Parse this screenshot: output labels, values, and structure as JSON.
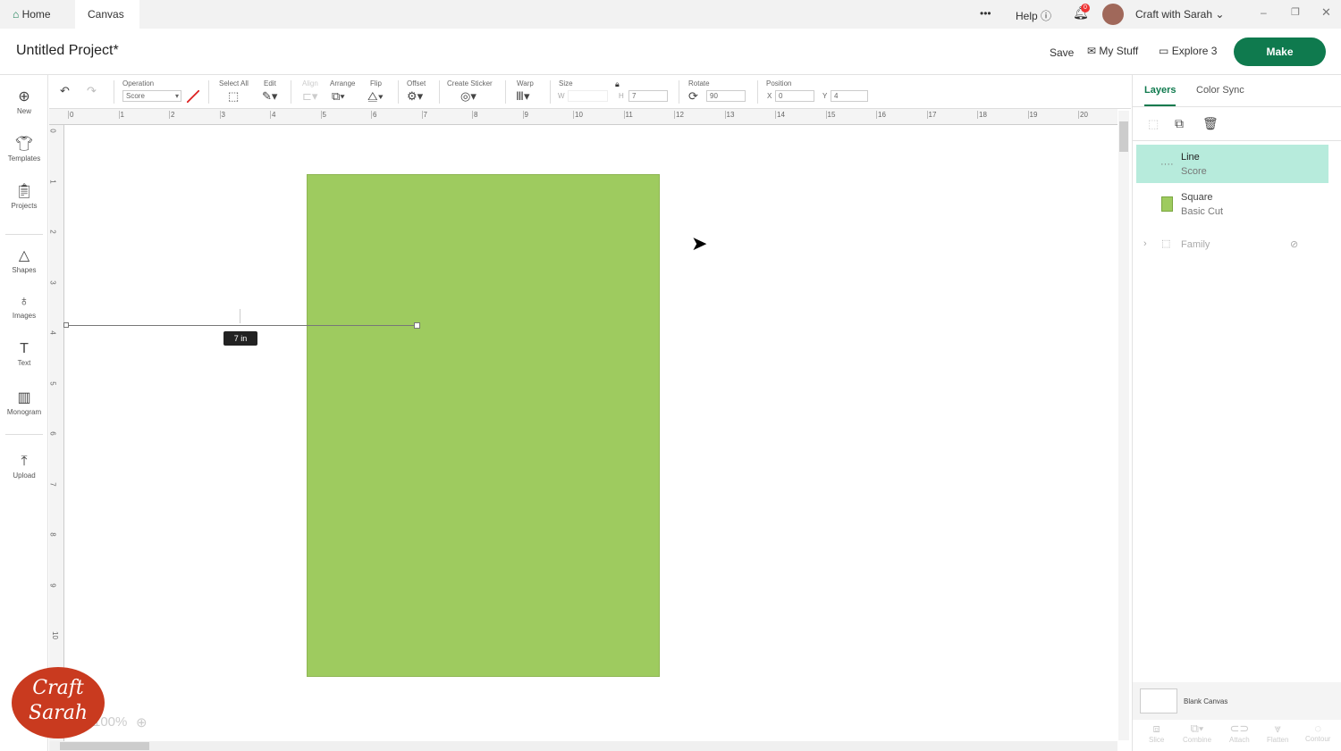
{
  "topbar": {
    "home": "Home",
    "canvas": "Canvas",
    "more": "•••",
    "help": "Help",
    "notif_count": "0",
    "user": "Craft with Sarah"
  },
  "header": {
    "title": "Untitled Project*",
    "save": "Save",
    "my_stuff": "My Stuff",
    "machine": "Explore 3",
    "make": "Make"
  },
  "toolbar": {
    "operation_label": "Operation",
    "operation_value": "Score",
    "select_all": "Select All",
    "edit": "Edit",
    "align": "Align",
    "arrange": "Arrange",
    "flip": "Flip",
    "offset": "Offset",
    "create_sticker": "Create Sticker",
    "warp": "Warp",
    "size": "Size",
    "w_label": "W",
    "w_value": "",
    "h_label": "H",
    "h_value": "7",
    "rotate": "Rotate",
    "rotate_value": "90",
    "position": "Position",
    "x_label": "X",
    "x_value": "0",
    "y_label": "Y",
    "y_value": "4"
  },
  "leftnav": [
    "New",
    "Templates",
    "Projects",
    "Shapes",
    "Images",
    "Text",
    "Monogram",
    "Upload"
  ],
  "ruler": {
    "h": [
      "0",
      "1",
      "2",
      "3",
      "4",
      "5",
      "6",
      "7",
      "8",
      "9",
      "10",
      "11",
      "12",
      "13",
      "14",
      "15",
      "16",
      "17",
      "18",
      "19",
      "20"
    ],
    "v": [
      "0",
      "1",
      "2",
      "3",
      "4",
      "5",
      "6",
      "7",
      "8",
      "9",
      "10"
    ]
  },
  "canvas": {
    "measure": "7 in",
    "zoom": "100%",
    "square_color": "#9ecb5f"
  },
  "panel": {
    "tab_layers": "Layers",
    "tab_color_sync": "Color Sync",
    "layers": [
      {
        "name": "Line",
        "op": "Score"
      },
      {
        "name": "Square",
        "op": "Basic Cut"
      },
      {
        "name": "Family",
        "op": ""
      }
    ],
    "blank_canvas": "Blank Canvas",
    "actions": [
      "Slice",
      "Combine",
      "Attach",
      "Flatten",
      "Contour"
    ]
  },
  "colors": {
    "accent": "#0f7a4e",
    "selected_layer": "#b7ebdc"
  }
}
